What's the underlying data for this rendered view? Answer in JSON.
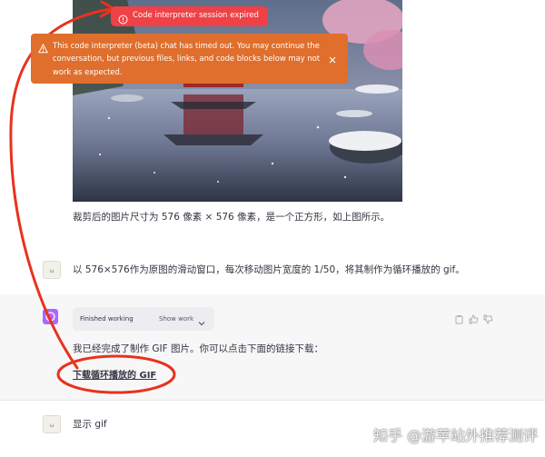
{
  "error_banner": {
    "text": "Code interpreter session expired",
    "icon": "alert-circle-icon",
    "color": "#ef4146"
  },
  "warning_banner": {
    "text": "This code interpreter (beta) chat has timed out. You may continue the conversation, but previous files, links, and code blocks below may not work as expected.",
    "icon": "warning-triangle-icon",
    "close_icon": "close-icon",
    "color": "#e06e2c"
  },
  "messages": {
    "caption": "裁剪后的图片尺寸为 576 像素 × 576 像素，是一个正方形，如上图所示。",
    "user_1": "以 576×576作为原图的滑动窗口，每次移动图片宽度的 1/50，将其制作为循环播放的 gif。",
    "working": {
      "label": "Finished working",
      "toggle": "Show work"
    },
    "assistant": "我已经完成了制作 GIF 图片。你可以点击下面的链接下载：",
    "download_link": "下载循环播放的 GIF",
    "user_2": "显示 gif"
  },
  "watermark": "知乎 @游苹站外推荐测评",
  "annotation_color": "#e8321e",
  "assistant_avatar_color": "#ab68ff"
}
